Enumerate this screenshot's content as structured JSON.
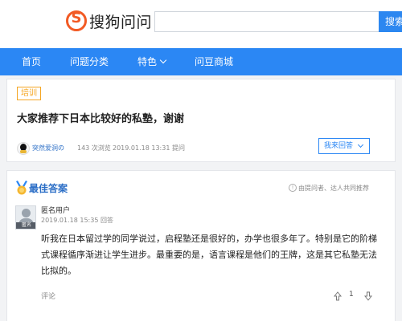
{
  "header": {
    "logo_text": "搜狗问问",
    "search_placeholder": "",
    "search_button": "搜索"
  },
  "nav": {
    "items": [
      {
        "label": "首页"
      },
      {
        "label": "问题分类"
      },
      {
        "label": "特色"
      },
      {
        "label": "问豆商城"
      }
    ]
  },
  "question": {
    "tag": "培训",
    "title": "大家推荐下日本比较好的私塾，谢谢",
    "asker": "突然爱洞の",
    "views": "143 次浏览",
    "time": "2019.01.18 13:31 提问",
    "answer_button": "我来回答"
  },
  "best_answer": {
    "title": "最佳答案",
    "note": "由提问者、达人共同推荐",
    "user": "匿名用户",
    "avatar_label": "匿名",
    "time": "2019.01.18 15:35 回答",
    "text": "听我在日本留过学的同学说过，启程塾还是很好的，办学也很多年了。特别是它的阶梯式课程循序渐进让学生进步。最重要的是，语言课程是他们的王牌，这是其它私塾无法比拟的。",
    "comment": "评论",
    "votes": "1"
  },
  "colors": {
    "brand": "#f25a24",
    "nav": "#2b87f4",
    "link": "#2b6ec6",
    "tag": "#f5a623"
  },
  "icons": [
    "sogou-logo-icon",
    "chevron-down-icon",
    "medal-icon",
    "info-icon",
    "qq-avatar-icon",
    "anonymous-avatar-icon",
    "thumb-up-icon",
    "thumb-down-icon"
  ]
}
